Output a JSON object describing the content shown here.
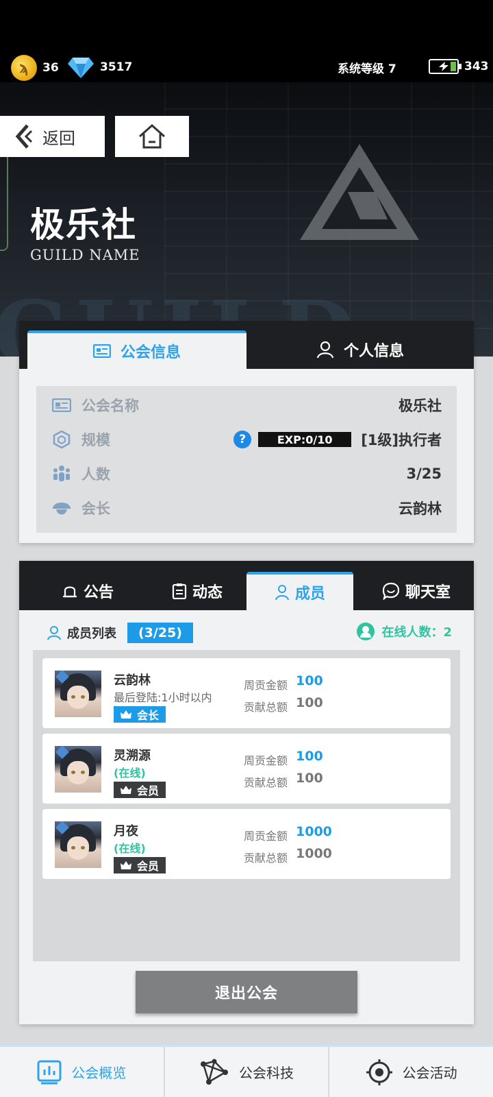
{
  "status": {
    "coins": "36",
    "diamonds": "3517",
    "system_level": "系统等级 7",
    "energy": "343"
  },
  "nav": {
    "back_label": "返回"
  },
  "guild": {
    "title": "极乐社",
    "subtitle": "GUILD NAME",
    "bg_text": "GUILD"
  },
  "info_card": {
    "tabs": [
      "公会信息",
      "个人信息"
    ],
    "rows": {
      "name": {
        "label": "公会名称",
        "value": "极乐社"
      },
      "scale": {
        "label": "规模",
        "exp": "EXP:0/10",
        "value": "[1级]执行者"
      },
      "count": {
        "label": "人数",
        "value": "3/25"
      },
      "leader": {
        "label": "会长",
        "value": "云韵林"
      }
    }
  },
  "member_card": {
    "tabs": [
      "公告",
      "动态",
      "成员",
      "聊天室"
    ],
    "list_label": "成员列表",
    "list_count": "(3/25)",
    "online_label": "在线人数：2",
    "members": [
      {
        "name": "云韵林",
        "status": "最后登陆:1小时以内",
        "role": "会长",
        "weekly_label": "周贡金额",
        "weekly": "100",
        "total_label": "贡献总额",
        "total": "100"
      },
      {
        "name": "灵溯源",
        "status": "(在线)",
        "role": "会员",
        "weekly_label": "周贡金额",
        "weekly": "100",
        "total_label": "贡献总额",
        "total": "100"
      },
      {
        "name": "月夜",
        "status": "(在线)",
        "role": "会员",
        "weekly_label": "周贡金额",
        "weekly": "1000",
        "total_label": "贡献总额",
        "total": "1000"
      }
    ],
    "leave_button": "退出公会"
  },
  "bottom_nav": [
    "公会概览",
    "公会科技",
    "公会活动"
  ],
  "colors": {
    "accent": "#2ea3e8",
    "online": "#2fc3a0",
    "dark": "#1d1f22"
  }
}
